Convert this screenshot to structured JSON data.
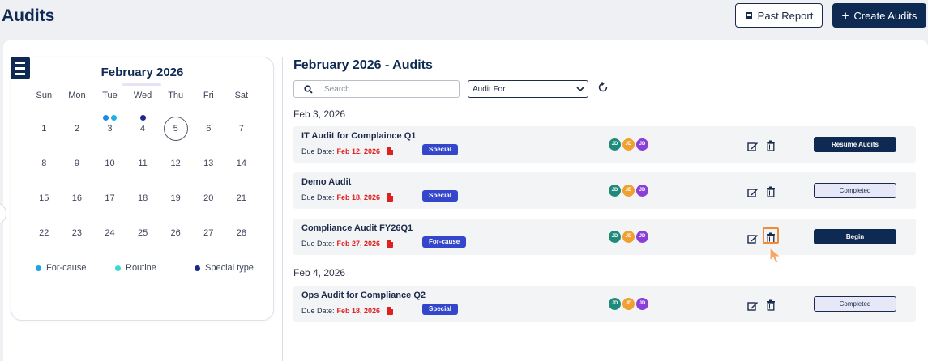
{
  "header": {
    "title": "Audits",
    "past_report_label": "Past Report",
    "create_label": "Create Audits",
    "create_plus": "+"
  },
  "calendar": {
    "month_label": "February 2026",
    "weekdays": [
      "Sun",
      "Mon",
      "Tue",
      "Wed",
      "Thu",
      "Fri",
      "Sat"
    ],
    "weeks": [
      [
        {
          "d": "1"
        },
        {
          "d": "2"
        },
        {
          "d": "3",
          "dots": [
            "#1e88e5",
            "#1fb1e6"
          ]
        },
        {
          "d": "4",
          "dots": [
            "#1b2a8a"
          ]
        },
        {
          "d": "5",
          "today": true
        },
        {
          "d": "6"
        },
        {
          "d": "7"
        }
      ],
      [
        {
          "d": "8"
        },
        {
          "d": "9"
        },
        {
          "d": "10"
        },
        {
          "d": "11"
        },
        {
          "d": "12"
        },
        {
          "d": "13"
        },
        {
          "d": "14"
        }
      ],
      [
        {
          "d": "15"
        },
        {
          "d": "16"
        },
        {
          "d": "17"
        },
        {
          "d": "18"
        },
        {
          "d": "19"
        },
        {
          "d": "20"
        },
        {
          "d": "21"
        }
      ],
      [
        {
          "d": "22"
        },
        {
          "d": "23"
        },
        {
          "d": "24"
        },
        {
          "d": "25"
        },
        {
          "d": "26"
        },
        {
          "d": "27"
        },
        {
          "d": "28"
        }
      ]
    ],
    "legend": [
      {
        "label": "For-cause",
        "color": "#1fa3e6"
      },
      {
        "label": "Routine",
        "color": "#3fd6d0"
      },
      {
        "label": "Special type",
        "color": "#1b2a8a"
      }
    ]
  },
  "audits_panel": {
    "title": "February 2026 - Audits",
    "search_placeholder": "Search",
    "filter_value": "Audit For",
    "groups": [
      {
        "date": "Feb 3, 2026",
        "rows": [
          {
            "title": "IT Audit for Complaince Q1",
            "due_label": "Due Date:",
            "due_date": "Feb 12, 2026",
            "tag": "Special",
            "action": "Resume Audits",
            "action_style": "dark"
          },
          {
            "title": "Demo Audit",
            "due_label": "Due Date:",
            "due_date": "Feb 18, 2026",
            "tag": "Special",
            "action": "Completed",
            "action_style": "light"
          },
          {
            "title": "Compliance Audit FY26Q1",
            "due_label": "Due Date:",
            "due_date": "Feb 27, 2026",
            "tag": "For-cause",
            "action": "Begin",
            "action_style": "dark",
            "delete_highlighted": true
          }
        ]
      },
      {
        "date": "Feb 4, 2026",
        "rows": [
          {
            "title": "Ops Audit for Compliance Q2",
            "due_label": "Due Date:",
            "due_date": "Feb 18, 2026",
            "tag": "Special",
            "action": "Completed",
            "action_style": "light"
          }
        ]
      }
    ],
    "avatars": [
      {
        "initials": "JD",
        "color": "#1f8a7a"
      },
      {
        "initials": "JD",
        "color": "#f0a030"
      },
      {
        "initials": "JD",
        "color": "#8a3fd6"
      }
    ]
  },
  "colors": {
    "brand_navy": "#0f2a52",
    "due_red": "#e01f1f",
    "tag_blue": "#3446c9",
    "highlight_orange": "#f28b35"
  }
}
